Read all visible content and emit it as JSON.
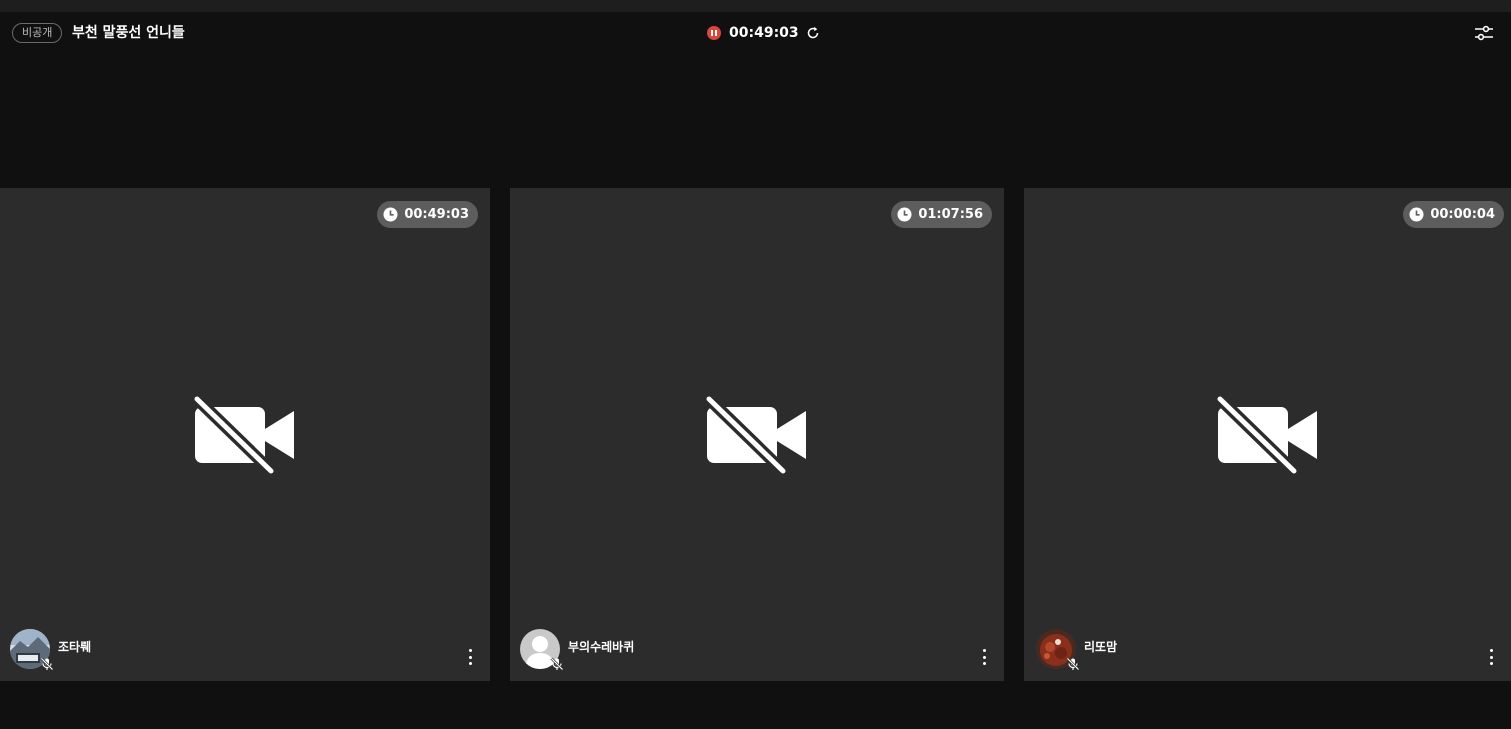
{
  "header": {
    "privacy_badge": "비공개",
    "room_title": "부천 말풍선 언니들",
    "recording_time": "00:49:03",
    "icons": {
      "recording": "record-pause-icon",
      "refresh": "refresh-icon",
      "settings": "settings-sliders-icon"
    }
  },
  "participants": [
    {
      "name": "조타뤠",
      "elapsed": "00:49:03",
      "avatar": "photo-avatar-landscape",
      "mic": "mic-muted-icon",
      "camera": "camera-off-icon"
    },
    {
      "name": "부의수레바퀴",
      "elapsed": "01:07:56",
      "avatar": "default-avatar",
      "mic": "mic-muted-icon",
      "camera": "camera-off-icon"
    },
    {
      "name": "리또맘",
      "elapsed": "00:00:04",
      "avatar": "photo-avatar-food",
      "mic": "mic-muted-icon",
      "camera": "camera-off-icon"
    }
  ],
  "colors": {
    "background": "#101010",
    "tile": "#2c2c2c",
    "timer_badge": "#5d5d5d",
    "recording": "#d9473a",
    "text": "#ffffff"
  }
}
